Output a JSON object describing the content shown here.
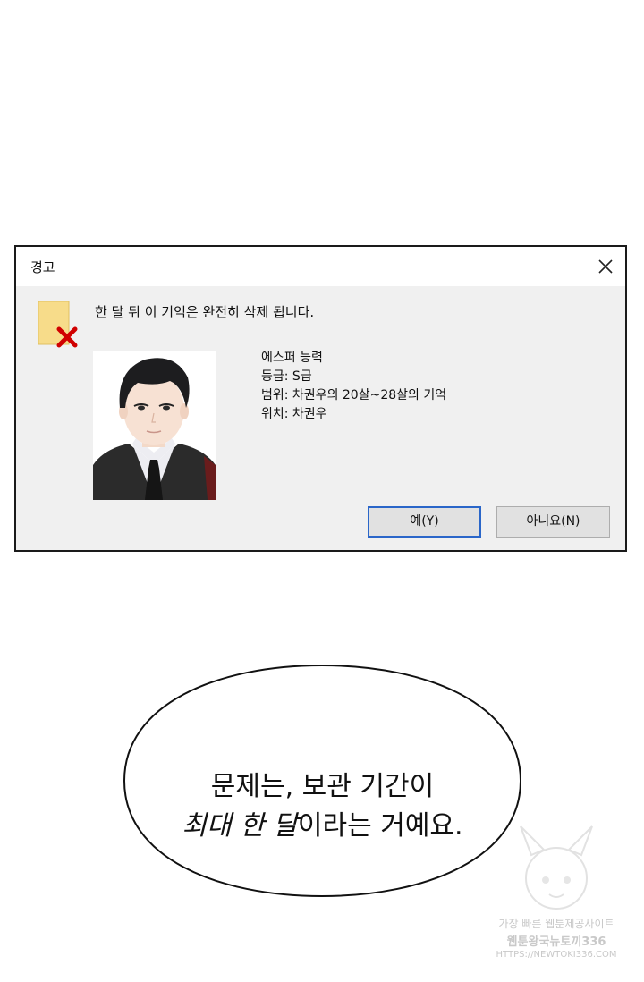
{
  "dialog": {
    "title": "경고",
    "message": "한 달 뒤 이 기억은 완전히 삭제 됩니다.",
    "info": {
      "line1": "에스퍼 능력",
      "line2": "등급: S급",
      "line3": "범위: 차권우의 20살~28살의 기억",
      "line4": "위치: 차권우"
    },
    "buttons": {
      "yes": "예(Y)",
      "no": "아니요(N)"
    },
    "icons": {
      "close": "close-icon",
      "file": "file-delete-icon",
      "photo": "portrait-photo"
    }
  },
  "speech": {
    "line1": "문제는, 보관 기간이",
    "line2_emphasis": "최대 한 달",
    "line2_rest": "이라는 거예요."
  },
  "watermark": {
    "line1": "가장 빠른 웹툰제공사이트",
    "line2": "웹툰왕국뉴토끼336",
    "line3": "HTTPS://NEWTOKI336.COM"
  },
  "colors": {
    "dialog_bg": "#f0f0f0",
    "primary_button_border": "#2a66c9",
    "file_icon": "#f7dc8a",
    "delete_x": "#d00000"
  }
}
